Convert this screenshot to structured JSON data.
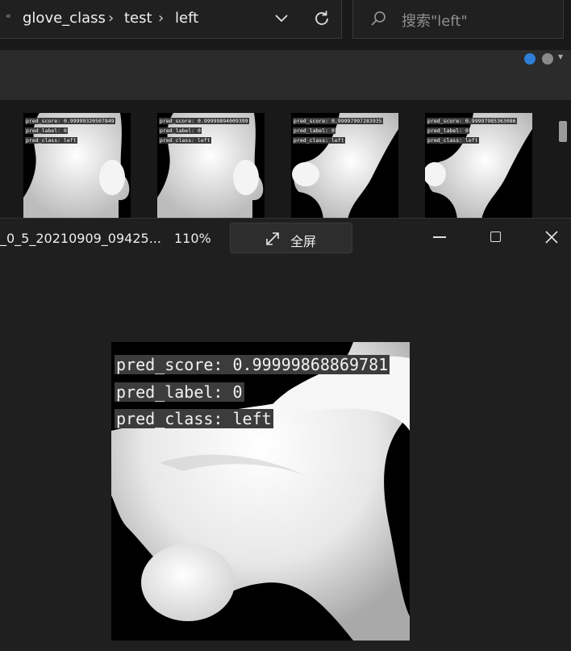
{
  "explorer": {
    "back_glyph": "«",
    "breadcrumb": [
      "glove_class",
      "test",
      "left"
    ],
    "breadcrumb_separator": "›",
    "search_placeholder": "搜索\"left\"",
    "thumbnails": [
      {
        "score": "pred_score: 0.99999320507849",
        "label": "pred_label: 0",
        "class": "pred_class: left"
      },
      {
        "score": "pred_score: 0.99999894009399",
        "label": "pred_label: 0",
        "class": "pred_class: left"
      },
      {
        "score": "pred_score: 0.99997997283935",
        "label": "pred_label: 0",
        "class": "pred_class: left"
      },
      {
        "score": "pred_score: 0.99997985363086",
        "label": "pred_label: 0",
        "class": "pred_class: left"
      }
    ]
  },
  "viewer": {
    "file_name": "_0_5_20210909_09425...",
    "zoom": "110%",
    "fullscreen_label": "全屏",
    "image": {
      "score": "pred_score: 0.99999868869781",
      "label": "pred_label: 0",
      "class": "pred_class: left"
    }
  },
  "colors": {
    "accent": "#2f7fd8",
    "background": "#1f1f1f"
  }
}
